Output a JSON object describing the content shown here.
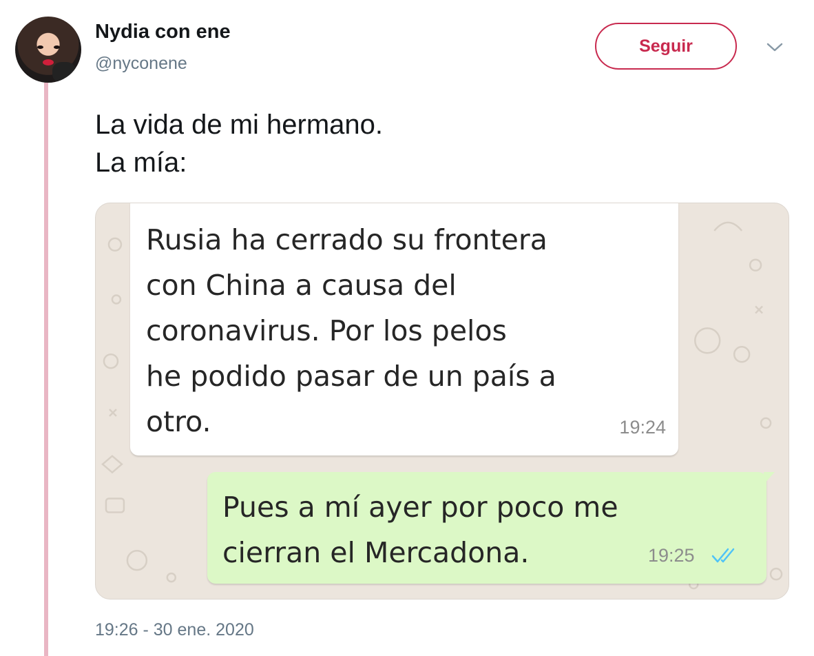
{
  "author": {
    "name": "Nydia con ene",
    "handle": "@nyconene"
  },
  "follow_label": "Seguir",
  "tweet": {
    "lines": [
      "La vida de mi hermano.",
      "La mía:"
    ],
    "timestamp": "19:26 - 30 ene. 2020"
  },
  "chat": {
    "incoming": {
      "lines": [
        "Rusia ha cerrado su frontera",
        "con China a causa del",
        "coronavirus. Por los pelos",
        "he podido pasar de un país a",
        "otro."
      ],
      "time": "19:24"
    },
    "outgoing": {
      "lines": [
        "Pues a mí ayer por poco me",
        "cierran el Mercadona."
      ],
      "time": "19:25"
    }
  },
  "colors": {
    "accent": "#c8294e",
    "thread_line": "#e9b6c4",
    "read_ticks": "#4fc3f7",
    "outgoing_bubble": "#dcf8c6",
    "chat_wallpaper": "#ece5dd"
  },
  "icons": {
    "more": "chevron-down-icon",
    "read_receipt": "double-check-icon"
  }
}
